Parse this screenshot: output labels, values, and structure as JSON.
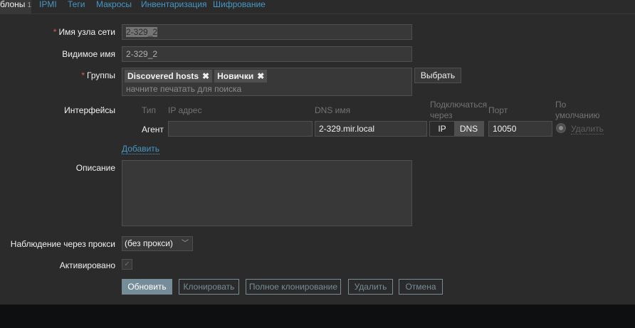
{
  "tabs": [
    {
      "label": "блоны",
      "count": "1",
      "active": true
    },
    {
      "label": "IPMI"
    },
    {
      "label": "Теги"
    },
    {
      "label": "Макросы"
    },
    {
      "label": "Инвентаризация"
    },
    {
      "label": "Шифрование"
    }
  ],
  "form": {
    "host_name": {
      "label": "Имя узла сети",
      "value": "2-329_2",
      "required": "*"
    },
    "visible_name": {
      "label": "Видимое имя",
      "value": "2-329_2"
    },
    "groups": {
      "label": "Группы",
      "required": "*",
      "chips": [
        "Discovered hosts",
        "Новички"
      ],
      "placeholder": "начните печатать для поиска",
      "select_button": "Выбрать",
      "remove_glyph": "✖"
    },
    "interfaces": {
      "label": "Интерфейсы",
      "headers": {
        "type": "Тип",
        "ip": "IP адрес",
        "dns": "DNS имя",
        "connect": "Подключаться через",
        "port": "Порт",
        "default": "По умолчанию"
      },
      "row": {
        "type": "Агент",
        "ip": "",
        "dns": "2-329.mir.local",
        "connect_options": [
          "IP",
          "DNS"
        ],
        "connect_selected": "DNS",
        "port": "10050",
        "remove": "Удалить"
      },
      "add": "Добавить"
    },
    "description": {
      "label": "Описание",
      "value": ""
    },
    "proxy": {
      "label": "Наблюдение через прокси",
      "value": "(без прокси)"
    },
    "enabled": {
      "label": "Активировано",
      "checked": true
    }
  },
  "buttons": {
    "update": "Обновить",
    "clone": "Клонировать",
    "full_clone": "Полное клонирование",
    "delete": "Удалить",
    "cancel": "Отмена"
  }
}
